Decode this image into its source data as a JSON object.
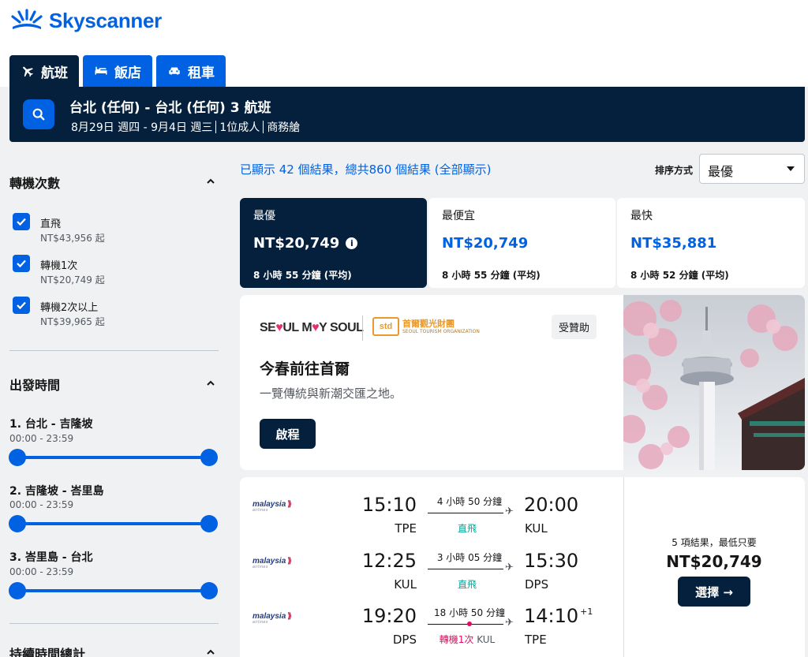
{
  "brand": {
    "name": "Skyscanner",
    "color": "#0062e3",
    "dark": "#05203c"
  },
  "tabs": [
    {
      "label": "航班",
      "icon": "plane-icon",
      "active": true
    },
    {
      "label": "飯店",
      "icon": "bed-icon",
      "active": false
    },
    {
      "label": "租車",
      "icon": "car-icon",
      "active": false
    }
  ],
  "search": {
    "route": "台北 (任何) - 台北 (任何) 3 航班",
    "dates": "8月29日 週四 - 9月4日 週三",
    "travellers": "1位成人",
    "cabin": "商務艙"
  },
  "filters": {
    "stops": {
      "title": "轉機次數",
      "options": [
        {
          "label": "直飛",
          "price": "NT$43,956 起",
          "checked": true
        },
        {
          "label": "轉機1次",
          "price": "NT$20,749 起",
          "checked": true
        },
        {
          "label": "轉機2次以上",
          "price": "NT$39,965 起",
          "checked": true
        }
      ]
    },
    "departure": {
      "title": "出發時間",
      "legs": [
        {
          "title": "1. 台北 - 吉隆坡",
          "range": "00:00 - 23:59"
        },
        {
          "title": "2. 吉隆坡 - 峇里島",
          "range": "00:00 - 23:59"
        },
        {
          "title": "3. 峇里島 - 台北",
          "range": "00:00 - 23:59"
        }
      ]
    },
    "duration": {
      "title": "持續時間總計"
    }
  },
  "results": {
    "summary": "已顯示 42 個結果，總共860 個結果 (全部顯示)",
    "sort_label": "排序方式",
    "sort_value": "最優"
  },
  "sort_cards": [
    {
      "label": "最優",
      "price": "NT$20,749",
      "time": "8 小時 55 分鐘 (平均)",
      "active": true
    },
    {
      "label": "最便宜",
      "price": "NT$20,749",
      "time": "8 小時 55 分鐘 (平均)",
      "active": false
    },
    {
      "label": "最快",
      "price": "NT$35,881",
      "time": "8 小時 52 分鐘 (平均)",
      "active": false
    }
  ],
  "ad": {
    "brand1_a": "SE",
    "brand1_heart": "♥",
    "brand1_b": "UL M",
    "brand1_c": "Y SOUL",
    "brand2_logo": "std",
    "brand2_name": "首爾觀光財團",
    "brand2_sub": "SEOUL TOURISM ORGANIZATION",
    "badge": "受贊助",
    "title": "今春前往首爾",
    "subtitle": "一覽傳統與新潮交匯之地。",
    "cta": "啟程"
  },
  "itinerary": {
    "airline": "malaysia",
    "airline_sub": "airlines",
    "legs": [
      {
        "dep_time": "15:10",
        "dep_code": "TPE",
        "duration": "4 小時 50 分鐘",
        "stops": "直飛",
        "arr_time": "20:00",
        "arr_code": "KUL",
        "day_offset": ""
      },
      {
        "dep_time": "12:25",
        "dep_code": "KUL",
        "duration": "3 小時 05 分鐘",
        "stops": "直飛",
        "arr_time": "15:30",
        "arr_code": "DPS",
        "day_offset": ""
      },
      {
        "dep_time": "19:20",
        "dep_code": "DPS",
        "duration": "18 小時 50 分鐘",
        "stops": "轉機1次",
        "stop_airport": "KUL",
        "arr_time": "14:10",
        "arr_code": "TPE",
        "day_offset": "+1"
      }
    ],
    "deal_text": "5 項結果，最低只要",
    "deal_price": "NT$20,749",
    "select_label": "選擇 →"
  }
}
